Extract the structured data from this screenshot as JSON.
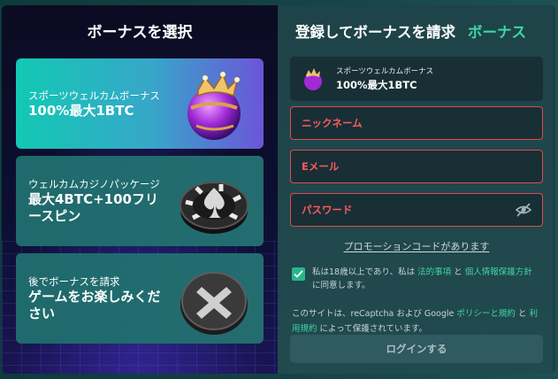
{
  "left": {
    "title": "ボーナスを選択",
    "cards": [
      {
        "small": "スポーツウェルカムボーナス",
        "big": "100%最大1BTC"
      },
      {
        "small": "ウェルカムカジノパッケージ",
        "big": "最大4BTC+100フリースピン"
      },
      {
        "small": "後でボーナスを請求",
        "big": "ゲームをお楽しみください"
      }
    ]
  },
  "right": {
    "title": "登録してボーナスを請求",
    "bonus_link": "ボーナス",
    "selected_bonus": {
      "small": "スポーツウェルカムボーナス",
      "big": "100%最大1BTC"
    },
    "fields": {
      "nickname_placeholder": "ニックネーム",
      "email_placeholder": "Eメール",
      "password_placeholder": "パスワード"
    },
    "promo_link": "プロモーションコードがあります",
    "consent": {
      "prefix": "私は18歳以上であり、私は ",
      "terms": "法的事項",
      "and": " と ",
      "privacy": "個人情報保護方針",
      "suffix": " に同意します。"
    },
    "recaptcha": {
      "prefix": "このサイトは、reCaptcha および Google ",
      "policy": "ポリシーと規約",
      "and": " と ",
      "terms": "利用規約",
      "suffix": " によって保護されています。"
    },
    "login_button": "ログインする"
  },
  "colors": {
    "accent": "#3fd6a3",
    "error": "#e04a4a",
    "left_bg": "#0a0c2a",
    "right_bg": "#1e4348"
  }
}
